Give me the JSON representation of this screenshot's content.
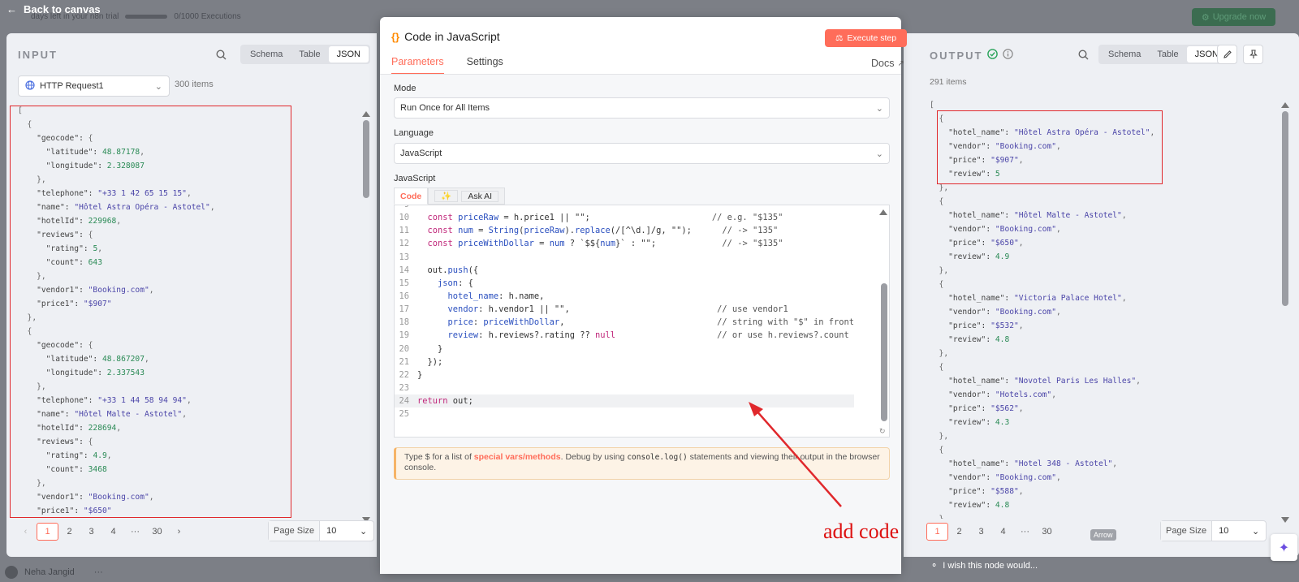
{
  "app": {
    "back_label": "Back to canvas",
    "trial_text": "days left in your n8n trial",
    "executions_text": "0/1000 Executions",
    "upgrade_label": "Upgrade now",
    "user_name": "Neha Jangid",
    "wish_text": "I wish this node would..."
  },
  "input_panel": {
    "title": "INPUT",
    "views": [
      "Schema",
      "Table",
      "JSON"
    ],
    "active_view": "JSON",
    "source_node": "HTTP Request1",
    "items_count": "300 items",
    "json_lines": [
      "[",
      "  {",
      "    \"geocode\": {",
      "      \"latitude\": 48.87178,",
      "      \"longitude\": 2.328087",
      "    },",
      "    \"telephone\": \"+33 1 42 65 15 15\",",
      "    \"name\": \"Hôtel Astra Opéra - Astotel\",",
      "    \"hotelId\": 229968,",
      "    \"reviews\": {",
      "      \"rating\": 5,",
      "      \"count\": 643",
      "    },",
      "    \"vendor1\": \"Booking.com\",",
      "    \"price1\": \"$907\"",
      "  },",
      "  {",
      "    \"geocode\": {",
      "      \"latitude\": 48.867207,",
      "      \"longitude\": 2.337543",
      "    },",
      "    \"telephone\": \"+33 1 44 58 94 94\",",
      "    \"name\": \"Hôtel Malte - Astotel\",",
      "    \"hotelId\": 228694,",
      "    \"reviews\": {",
      "      \"rating\": 4.9,",
      "      \"count\": 3468",
      "    },",
      "    \"vendor1\": \"Booking.com\",",
      "    \"price1\": \"$650\""
    ],
    "pagination": [
      "1",
      "2",
      "3",
      "4",
      "···",
      "30"
    ],
    "current_page": "1",
    "page_size_label": "Page Size",
    "page_size_value": "10"
  },
  "node": {
    "title": "Code in JavaScript",
    "execute_label": "Execute step",
    "tabs": [
      "Parameters",
      "Settings"
    ],
    "active_tab": "Parameters",
    "docs_label": "Docs",
    "mode_label": "Mode",
    "mode_value": "Run Once for All Items",
    "language_label": "Language",
    "language_value": "JavaScript",
    "js_label": "JavaScript",
    "code_tabs": [
      "Code",
      "Ask AI"
    ],
    "code_lines": [
      {
        "n": "9",
        "t": ""
      },
      {
        "n": "10",
        "t": "  const priceRaw = h.price1 || \"\";                        // e.g. \"$135\""
      },
      {
        "n": "11",
        "t": "  const num = String(priceRaw).replace(/[^\\d.]/g, \"\");      // -> \"135\""
      },
      {
        "n": "12",
        "t": "  const priceWithDollar = num ? `$${num}` : \"\";             // -> \"$135\""
      },
      {
        "n": "13",
        "t": ""
      },
      {
        "n": "14",
        "t": "  out.push({"
      },
      {
        "n": "15",
        "t": "    json: {"
      },
      {
        "n": "16",
        "t": "      hotel_name: h.name,"
      },
      {
        "n": "17",
        "t": "      vendor: h.vendor1 || \"\",                             // use vendor1"
      },
      {
        "n": "18",
        "t": "      price: priceWithDollar,                              // string with \"$\" in front"
      },
      {
        "n": "19",
        "t": "      review: h.reviews?.rating ?? null                    // or use h.reviews?.count"
      },
      {
        "n": "20",
        "t": "    }"
      },
      {
        "n": "21",
        "t": "  });"
      },
      {
        "n": "22",
        "t": "}"
      },
      {
        "n": "23",
        "t": ""
      },
      {
        "n": "24",
        "t": "return out;"
      },
      {
        "n": "25",
        "t": ""
      }
    ],
    "hint_prefix": "Type $ for a list of ",
    "hint_link": "special vars/methods",
    "hint_mid": ". Debug by using ",
    "hint_code": "console.log()",
    "hint_suffix": " statements and viewing their output in the browser console."
  },
  "output_panel": {
    "title": "OUTPUT",
    "views": [
      "Schema",
      "Table",
      "JSON"
    ],
    "active_view": "JSON",
    "items_count": "291 items",
    "json_lines": [
      "[",
      "  {",
      "    \"hotel_name\": \"Hôtel Astra Opéra - Astotel\",",
      "    \"vendor\": \"Booking.com\",",
      "    \"price\": \"$907\",",
      "    \"review\": 5",
      "  },",
      "  {",
      "    \"hotel_name\": \"Hôtel Malte - Astotel\",",
      "    \"vendor\": \"Booking.com\",",
      "    \"price\": \"$650\",",
      "    \"review\": 4.9",
      "  },",
      "  {",
      "    \"hotel_name\": \"Victoria Palace Hotel\",",
      "    \"vendor\": \"Booking.com\",",
      "    \"price\": \"$532\",",
      "    \"review\": 4.8",
      "  },",
      "  {",
      "    \"hotel_name\": \"Novotel Paris Les Halles\",",
      "    \"vendor\": \"Hotels.com\",",
      "    \"price\": \"$562\",",
      "    \"review\": 4.3",
      "  },",
      "  {",
      "    \"hotel_name\": \"Hotel 348 - Astotel\",",
      "    \"vendor\": \"Booking.com\",",
      "    \"price\": \"$588\",",
      "    \"review\": 4.8",
      "  },"
    ],
    "pagination": [
      "1",
      "2",
      "3",
      "4",
      "···",
      "30"
    ],
    "current_page": "1",
    "page_size_label": "Page Size",
    "page_size_value": "10",
    "tooltip": "Arrow"
  },
  "annotation": {
    "text": "add code",
    "color": "#d11111"
  },
  "colors": {
    "accent": "#ff6d5a",
    "success": "#29a35a",
    "annotation": "#e0282c"
  }
}
